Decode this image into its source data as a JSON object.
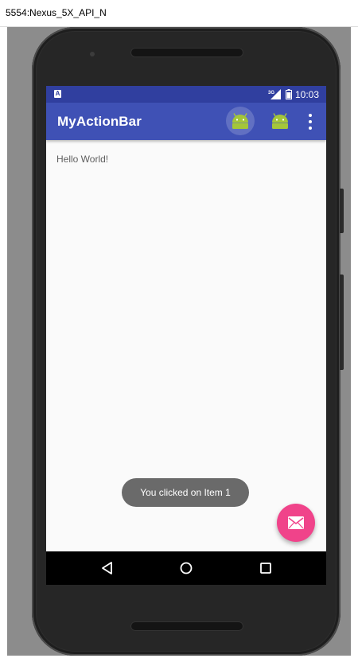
{
  "window": {
    "title": "5554:Nexus_5X_API_N"
  },
  "statusbar": {
    "notification_icon": "A",
    "network_type": "3G",
    "time": "10:03"
  },
  "appbar": {
    "title": "MyActionBar",
    "actions": [
      {
        "icon": "android-icon",
        "pressed": true
      },
      {
        "icon": "android-icon",
        "pressed": false
      }
    ],
    "overflow_icon": "more-vert-icon"
  },
  "content": {
    "text": "Hello World!"
  },
  "toast": {
    "message": "You clicked on Item 1"
  },
  "fab": {
    "icon": "email-icon",
    "color": "#f0438a"
  },
  "navbar": {
    "buttons": [
      "back-icon",
      "home-icon",
      "recents-icon"
    ]
  },
  "colors": {
    "primary": "#3f51b5",
    "primary_dark": "#303f9f",
    "accent": "#f0438a",
    "android_green": "#a4c639"
  }
}
